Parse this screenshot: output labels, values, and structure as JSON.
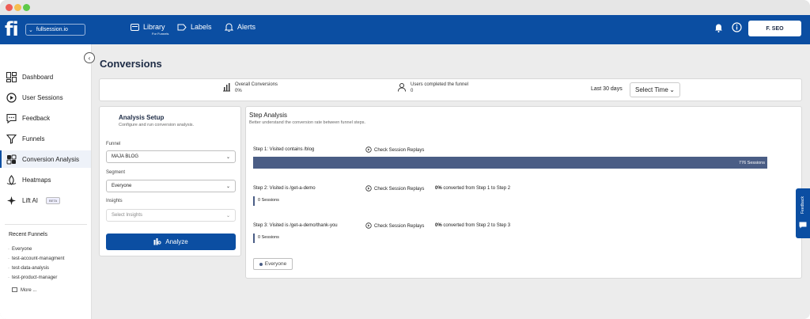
{
  "topnav": {
    "logo": "fi",
    "site": "fullsession.io",
    "library_label": "Library",
    "library_sub": "For Funnels",
    "labels_label": "Labels",
    "alerts_label": "Alerts",
    "user_label": "F. SEO"
  },
  "sidebar": {
    "items": [
      {
        "label": "Dashboard",
        "icon": "dashboard-icon"
      },
      {
        "label": "User Sessions",
        "icon": "play-circle-icon"
      },
      {
        "label": "Feedback",
        "icon": "chat-icon"
      },
      {
        "label": "Funnels",
        "icon": "funnel-icon"
      },
      {
        "label": "Conversion Analysis",
        "icon": "conversion-icon",
        "active": true
      },
      {
        "label": "Heatmaps",
        "icon": "heatmap-icon"
      },
      {
        "label": "Lift AI",
        "icon": "sparkle-icon",
        "badge": "BETA"
      }
    ],
    "recent_title": "Recent Funnels",
    "recent": [
      "Everyone",
      "test-account-managment",
      "test-data-analysis",
      "test-product-manager"
    ],
    "more_label": "More ..."
  },
  "page": {
    "title": "Conversions"
  },
  "summary": {
    "overall_label": "Overall Conversions",
    "overall_value": "0%",
    "users_label": "Users completed the funnel",
    "users_value": "0",
    "period": "Last 30 days",
    "time_select": "Select Time"
  },
  "setup": {
    "title": "Analysis Setup",
    "subtitle": "Configure and run conversion analysis.",
    "funnel_label": "Funnel",
    "funnel_value": "MAJA BLOG",
    "segment_label": "Segment",
    "segment_value": "Everyone",
    "insights_label": "Insights",
    "insights_placeholder": "Select Insights",
    "analyze_label": "Analyze"
  },
  "steps": {
    "title": "Step Analysis",
    "subtitle": "Better understand the conversion rate between funnel steps.",
    "replay_label": "Check Session Replays",
    "items": [
      {
        "label": "Step 1: Visited contains /blog",
        "sessions": "776 Sessions",
        "share": 1.0
      },
      {
        "label": "Step 2: Visited is /get-a-demo",
        "sessions": "0 Sessions",
        "conv_pct": "0%",
        "conv_text": "converted from Step 1 to Step 2",
        "share": 0
      },
      {
        "label": "Step 3: Visited is /get-a-demo/thank-you",
        "sessions": "0 Sessions",
        "conv_pct": "0%",
        "conv_text": "converted from Step 2 to Step 3",
        "share": 0
      }
    ],
    "legend": "Everyone"
  },
  "feedback_tab": "Feedback",
  "colors": {
    "brand": "#0b4ea2",
    "bar": "#4a5d85"
  }
}
